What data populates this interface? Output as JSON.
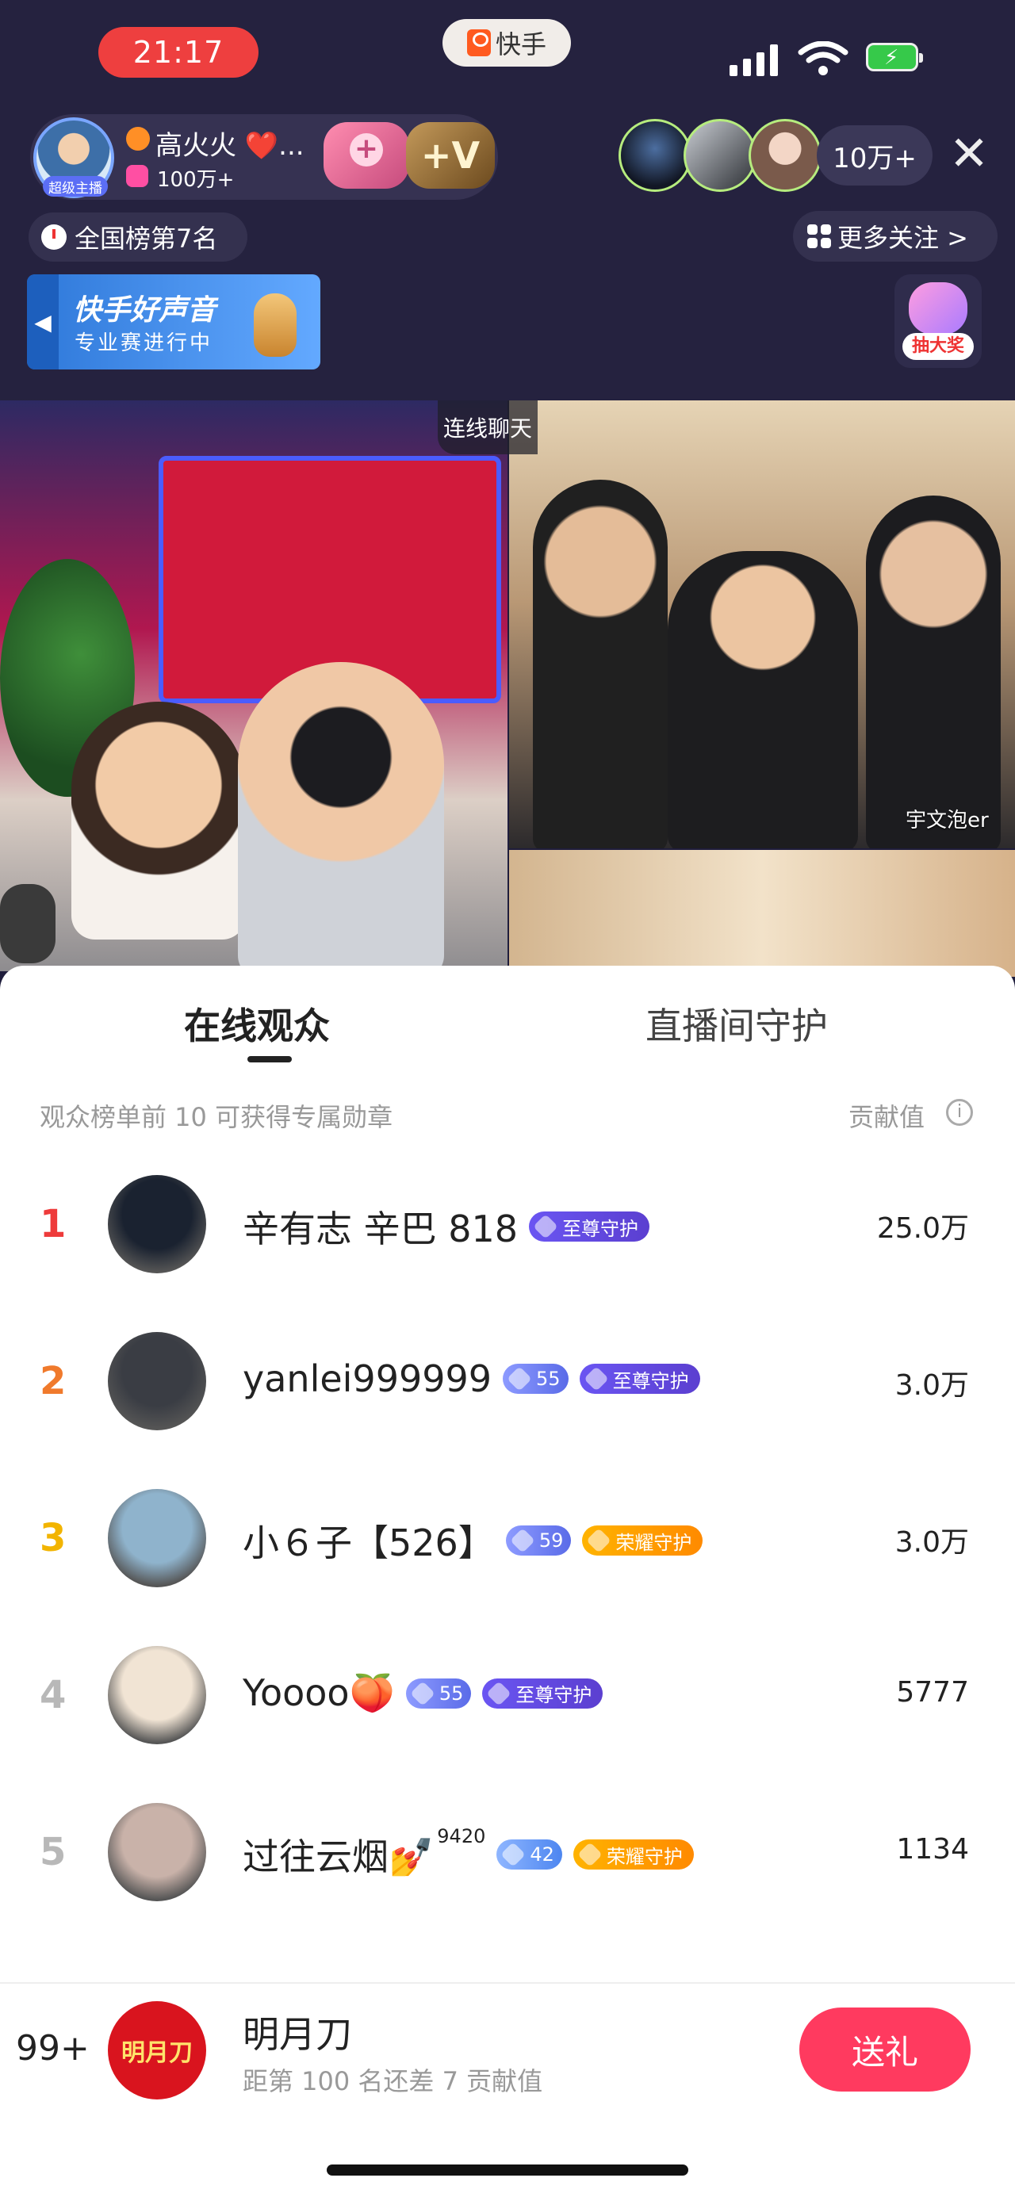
{
  "status": {
    "time": "21:17",
    "app_name": "快手"
  },
  "host": {
    "name": "高火火 ❤️...",
    "fans": "100万+",
    "tag": "超级主播",
    "follow_plus": "+",
    "v_label": "+V"
  },
  "viewers": {
    "count": "10万+",
    "close": "✕"
  },
  "rank_badge": "全国榜第7名",
  "more_follow": "更多关注 >",
  "banner": {
    "title": "快手好声音",
    "subtitle": "专业赛进行中",
    "arrow": "◀"
  },
  "draw_prize": "抽大奖",
  "video": {
    "link_label": "连线聊天",
    "cam_name": "宇文泡er"
  },
  "tabs": [
    {
      "label": "在线观众"
    },
    {
      "label": "直播间守护"
    }
  ],
  "hint": "观众榜单前 10 可获得专属勋章",
  "contrib_label": "贡献值",
  "ranking": [
    {
      "rank": "1",
      "name": "辛有志 辛巴 818",
      "level": "",
      "sup": "",
      "badge": "至尊守护",
      "badge_type": "purple",
      "score": "25.0万",
      "rank_color": "#ee3b3b",
      "avatar_color": "#1a2230"
    },
    {
      "rank": "2",
      "name": "yanlei999999",
      "level": "55",
      "sup": "",
      "badge": "至尊守护",
      "badge_type": "purple",
      "score": "3.0万",
      "rank_color": "#f07a2c",
      "avatar_color": "#3a3d44"
    },
    {
      "rank": "3",
      "name": "小６子【526】",
      "level": "59",
      "sup": "",
      "badge": "荣耀守护",
      "badge_type": "gold",
      "score": "3.0万",
      "rank_color": "#f2b400",
      "avatar_color": "#8fb3cc"
    },
    {
      "rank": "4",
      "name": "Yoooo🍑",
      "level": "55",
      "sup": "",
      "badge": "至尊守护",
      "badge_type": "purple",
      "score": "5777",
      "rank_color": "#b8b8b8",
      "avatar_color": "#f1e4d4"
    },
    {
      "rank": "5",
      "name": "过往云烟💅",
      "level": "42",
      "sup": "9420",
      "badge": "荣耀守护",
      "badge_type": "gold",
      "score": "1134",
      "rank_color": "#b8b8b8",
      "avatar_color": "#c9b2a9"
    }
  ],
  "me": {
    "rank": "99+",
    "avatar_text": "明月刀",
    "name": "明月刀",
    "gap_text": "距第 100 名还差 7 贡献值",
    "gift_label": "送礼"
  },
  "colors": {
    "accent": "#ff3a5f",
    "top_bg": "#25223f"
  },
  "icons": [
    "signal-icon",
    "wifi-icon",
    "battery-icon",
    "clock-icon",
    "grid-icon",
    "close-icon",
    "info-icon",
    "diamond-icon",
    "crown-icon"
  ]
}
